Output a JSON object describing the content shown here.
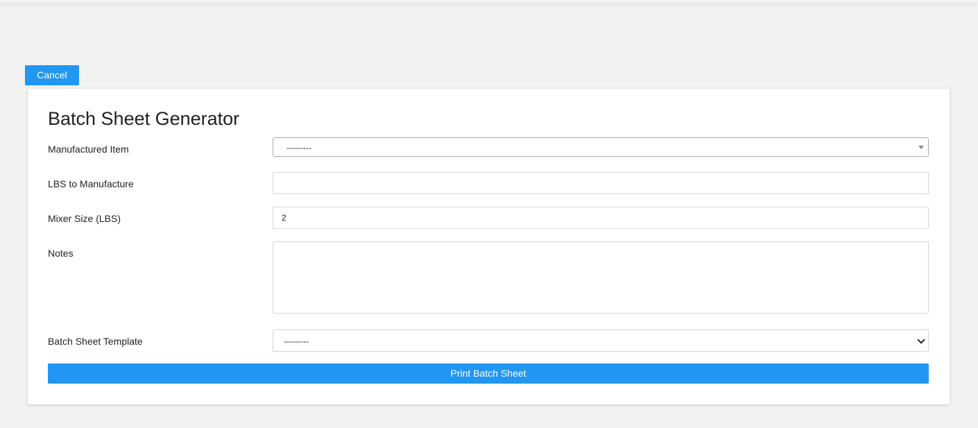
{
  "toolbar": {
    "cancel_label": "Cancel"
  },
  "form": {
    "title": "Batch Sheet Generator",
    "manufactured_item": {
      "label": "Manufactured Item",
      "selected": "---------"
    },
    "lbs_to_manufacture": {
      "label": "LBS to Manufacture",
      "value": ""
    },
    "mixer_size": {
      "label": "Mixer Size (LBS)",
      "value": "2"
    },
    "notes": {
      "label": "Notes",
      "value": ""
    },
    "batch_sheet_template": {
      "label": "Batch Sheet Template",
      "selected": "---------"
    },
    "submit_label": "Print Batch Sheet"
  },
  "colors": {
    "accent": "#2196f3",
    "background": "#f2f2f2",
    "card": "#ffffff"
  }
}
